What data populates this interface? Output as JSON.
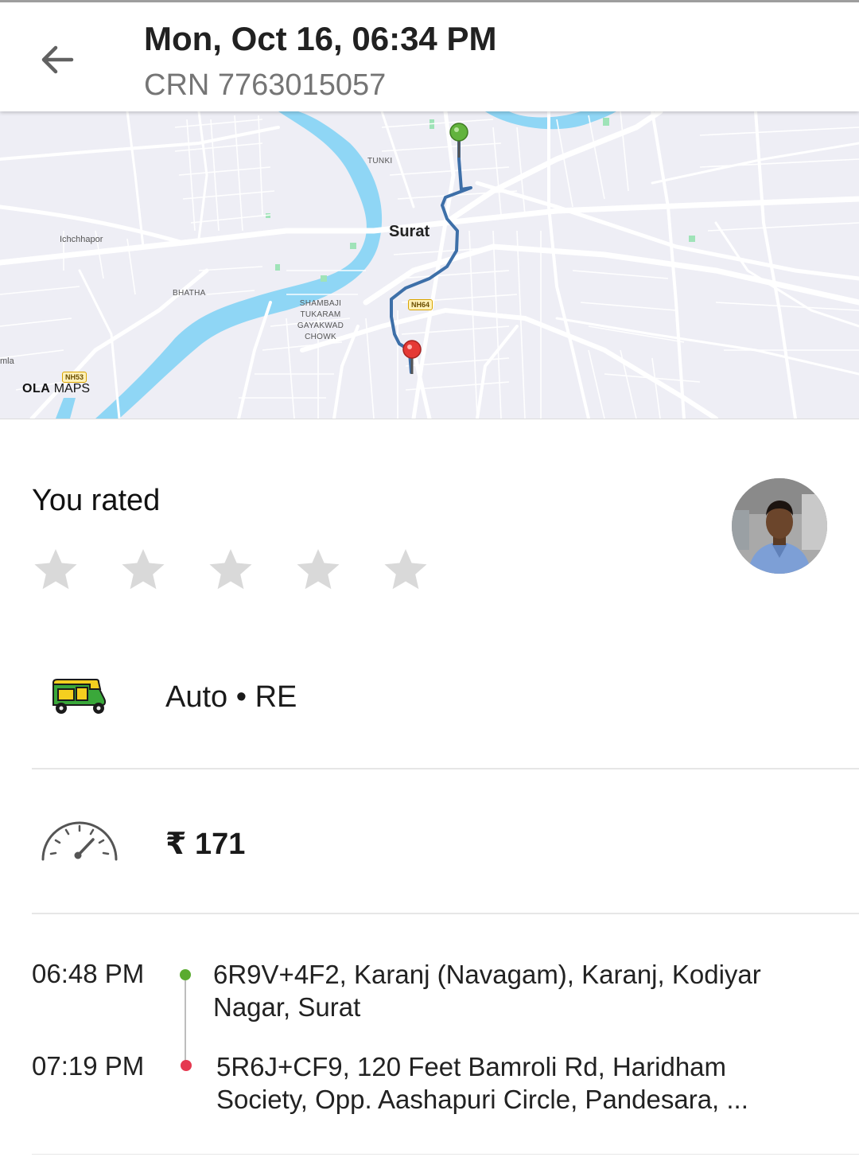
{
  "header": {
    "title": "Mon, Oct 16, 06:34 PM",
    "crn": "CRN 7763015057"
  },
  "map": {
    "labels": {
      "tunki": "TUNKI",
      "surat": "Surat",
      "ichchhapor": "Ichchhapor",
      "bhatha": "BHATHA",
      "shambaji": "SHAMBAJI",
      "tukaram": "TUKARAM",
      "gayakwad": "GAYAKWAD",
      "chowk": "CHOWK",
      "edge": "mla"
    },
    "road_badges": {
      "nh64": "NH64",
      "nh53": "NH53"
    },
    "logo": {
      "bold": "OLA",
      "rest": " MAPS"
    },
    "route_color": "#3d6fa8",
    "pickup_pin_color": "#62b33d",
    "drop_pin_color": "#e53935",
    "water_color": "#8fd6f5"
  },
  "rating": {
    "title": "You rated",
    "stars_total": 5,
    "stars_filled": 0,
    "star_color": "#d9d9d9"
  },
  "vehicle": {
    "icon": "auto-rickshaw-icon",
    "label": "Auto • RE"
  },
  "fare": {
    "icon": "speedometer-icon",
    "amount": "₹ 171"
  },
  "trip": {
    "pickup": {
      "time": "06:48 PM",
      "address": "6R9V+4F2, Karanj (Navagam), Karanj, Kodiyar Nagar, Surat",
      "dot_color": "#5aab2f"
    },
    "drop": {
      "time": "07:19 PM",
      "address": "5R6J+CF9, 120 Feet Bamroli Rd, Haridham Society, Opp. Aashapuri Circle, Pandesara, ...",
      "dot_color": "#e53950"
    }
  }
}
